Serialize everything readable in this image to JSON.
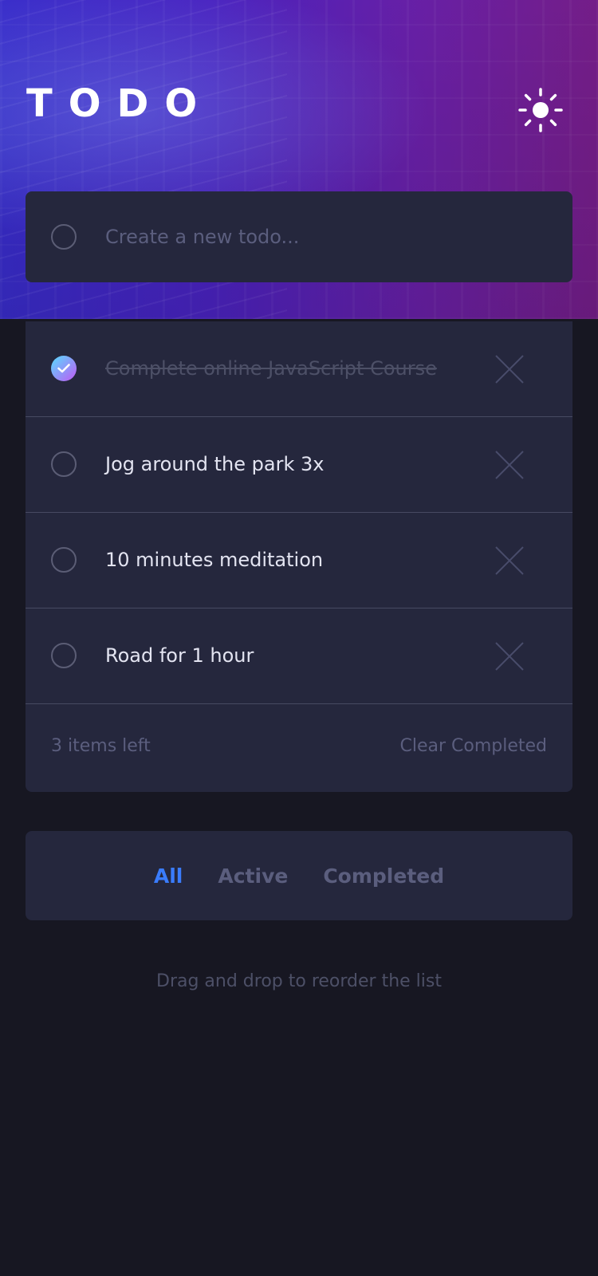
{
  "header": {
    "title": "TODO",
    "theme_icon": "sun-icon"
  },
  "new_todo": {
    "placeholder": "Create a new todo..."
  },
  "todos": [
    {
      "text": "Complete online JavaScript Course",
      "completed": true
    },
    {
      "text": "Jog around the park 3x",
      "completed": false
    },
    {
      "text": "10 minutes meditation",
      "completed": false
    },
    {
      "text": "Road for 1 hour",
      "completed": false
    }
  ],
  "footer": {
    "items_left": "3 items left",
    "clear_label": "Clear Completed"
  },
  "filters": {
    "all": "All",
    "active": "Active",
    "completed": "Completed",
    "selected": "All"
  },
  "hint": "Drag and drop to reorder the list",
  "colors": {
    "background": "#171722",
    "card": "#25273d",
    "accent": "#3a7cfd",
    "check_gradient_start": "#57ddff",
    "check_gradient_end": "#c058f3"
  }
}
